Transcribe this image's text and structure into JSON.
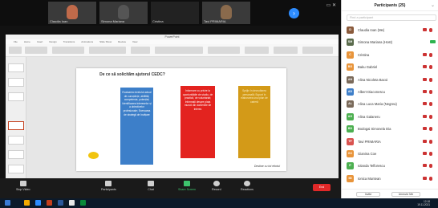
{
  "tiles": [
    {
      "name": "Claudia Ioan",
      "face": "#c06a4a"
    },
    {
      "name": "Simona Mariana",
      "face": "#3a3a3a"
    },
    {
      "name": "Cristina",
      "face": "#2f2f2f"
    },
    {
      "name": "Tavi PRIMARIA",
      "face": "#8a6a4c"
    }
  ],
  "slide": {
    "title": "De ce să solicităm ajutorul CEDC?",
    "blue_text": "Evaluarea nivelului actual de cunoștințe, abilități, competențe, potențial; Identificarea intereselor și a obiectivelor profesionale; Exersarea de strategii de învățare",
    "red_text": "Informare cu privire la oportunitățile de studiu, de practică, de voluntariat; Informații despre piața muncii din domeniile de interes",
    "yellow_text": "Sprijin în dezvoltarea personală; Suport în elaborarea unui plan de carieră",
    "footer": "Destine cu tot efortul"
  },
  "toolbar": {
    "stop_video": "Stop Video",
    "participants": "Participants",
    "participants_count": "25",
    "chat": "Chat",
    "share_screen": "Share Screen",
    "record": "Record",
    "reactions": "Reactions",
    "end": "End"
  },
  "panel": {
    "title": "Participants (25)",
    "search_placeholder": "Find a participant",
    "participants": [
      {
        "name": "Claudia Ioan (Me)",
        "initials": "CI",
        "color": "#8a5a3b"
      },
      {
        "name": "Simona Mariana (Host)",
        "initials": "SM",
        "color": "#5a6b4c"
      },
      {
        "name": "Cristina",
        "initials": "C",
        "color": "#e8943a"
      },
      {
        "name": "Baku Gabriel",
        "initials": "BG",
        "color": "#e8943a"
      },
      {
        "name": "Alina Nicoleta Bacoi",
        "initials": "AN",
        "color": "#7a6a5a"
      },
      {
        "name": "Albert Diaconescu",
        "initials": "AD",
        "color": "#3e7fc9"
      },
      {
        "name": "Alina Luca Maria (Negrea)",
        "initials": "AL",
        "color": "#7a6a5a"
      },
      {
        "name": "Alina Galaneru",
        "initials": "AG",
        "color": "#4caf50"
      },
      {
        "name": "Bodogai Simonela Dia",
        "initials": "BD",
        "color": "#4caf50"
      },
      {
        "name": "Tavi PRIMARIA",
        "initials": "TP",
        "color": "#d9534f"
      },
      {
        "name": "Gianina Coe",
        "initials": "GC",
        "color": "#e8943a"
      },
      {
        "name": "Iolanda Teflorescu",
        "initials": "IT",
        "color": "#4caf50"
      },
      {
        "name": "Ionica Muntean",
        "initials": "IM",
        "color": "#e8943a"
      }
    ],
    "invite": "Invite",
    "unmute_me": "Unmute Me"
  },
  "taskbar": {
    "time": "12:18",
    "date": "19.11.2021"
  }
}
